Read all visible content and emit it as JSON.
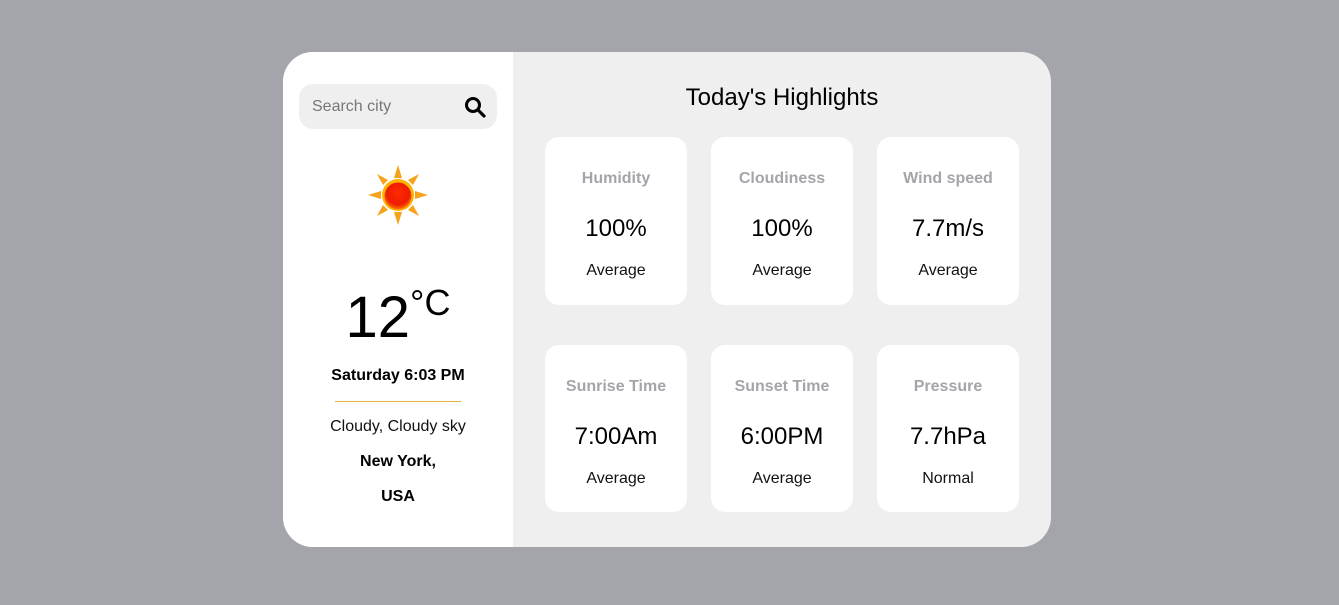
{
  "search": {
    "placeholder": "Search city"
  },
  "current": {
    "icon": "sun-icon",
    "temperature": "12",
    "unit": "°C",
    "datetime": "Saturday 6:03 PM",
    "condition": "Cloudy, Cloudy sky",
    "city": "New York,",
    "country": "USA"
  },
  "highlights": {
    "title": "Today's Highlights",
    "tiles": [
      {
        "label": "Humidity",
        "value": "100%",
        "status": "Average"
      },
      {
        "label": "Cloudiness",
        "value": "100%",
        "status": "Average"
      },
      {
        "label": "Wind speed",
        "value": "7.7m/s",
        "status": "Average"
      },
      {
        "label": "Sunrise Time",
        "value": "7:00Am",
        "status": "Average"
      },
      {
        "label": "Sunset Time",
        "value": "6:00PM",
        "status": "Average"
      },
      {
        "label": "Pressure",
        "value": "7.7hPa",
        "status": "Normal"
      }
    ]
  },
  "colors": {
    "background": "#a4a5aa",
    "panel": "#efefef",
    "card": "#ffffff",
    "divider": "#e0b23a",
    "label_gray": "#a4a5aa"
  }
}
